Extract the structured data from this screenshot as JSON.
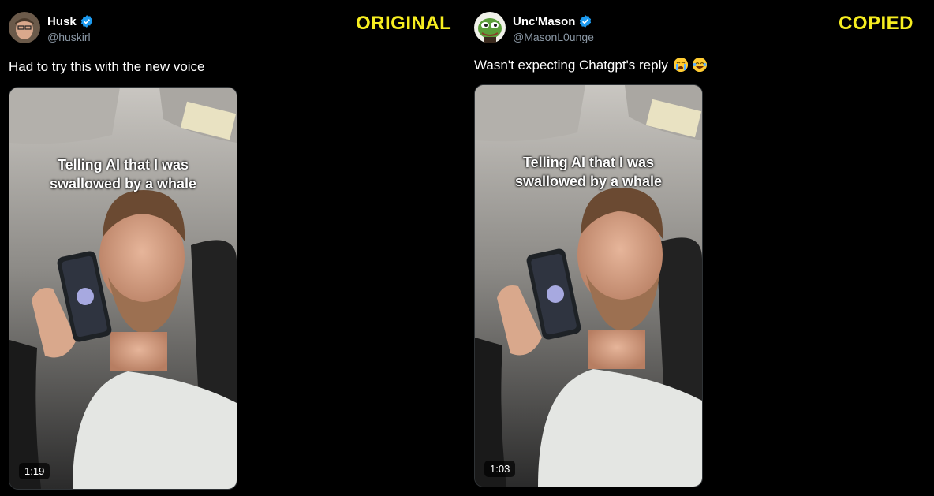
{
  "posts": [
    {
      "name": "Husk",
      "handle": "@huskirl",
      "tag": "ORIGINAL",
      "text": "Had to try this with the new voice",
      "video_caption_line1": "Telling AI that I was",
      "video_caption_line2": "swallowed by a whale",
      "duration": "1:19"
    },
    {
      "name": "Unc'Mason",
      "handle": "@MasonL0unge",
      "tag": "COPIED",
      "text": "Wasn't expecting Chatgpt's reply",
      "emojis": [
        "loudly-crying-face",
        "tears-of-joy-face"
      ],
      "video_caption_line1": "Telling AI that I was",
      "video_caption_line2": "swallowed by a whale",
      "duration": "1:03"
    }
  ],
  "colors": {
    "background": "#000000",
    "tag": "#f7ee20",
    "verified": "#1d9bf0",
    "handle": "#8b98a5"
  }
}
